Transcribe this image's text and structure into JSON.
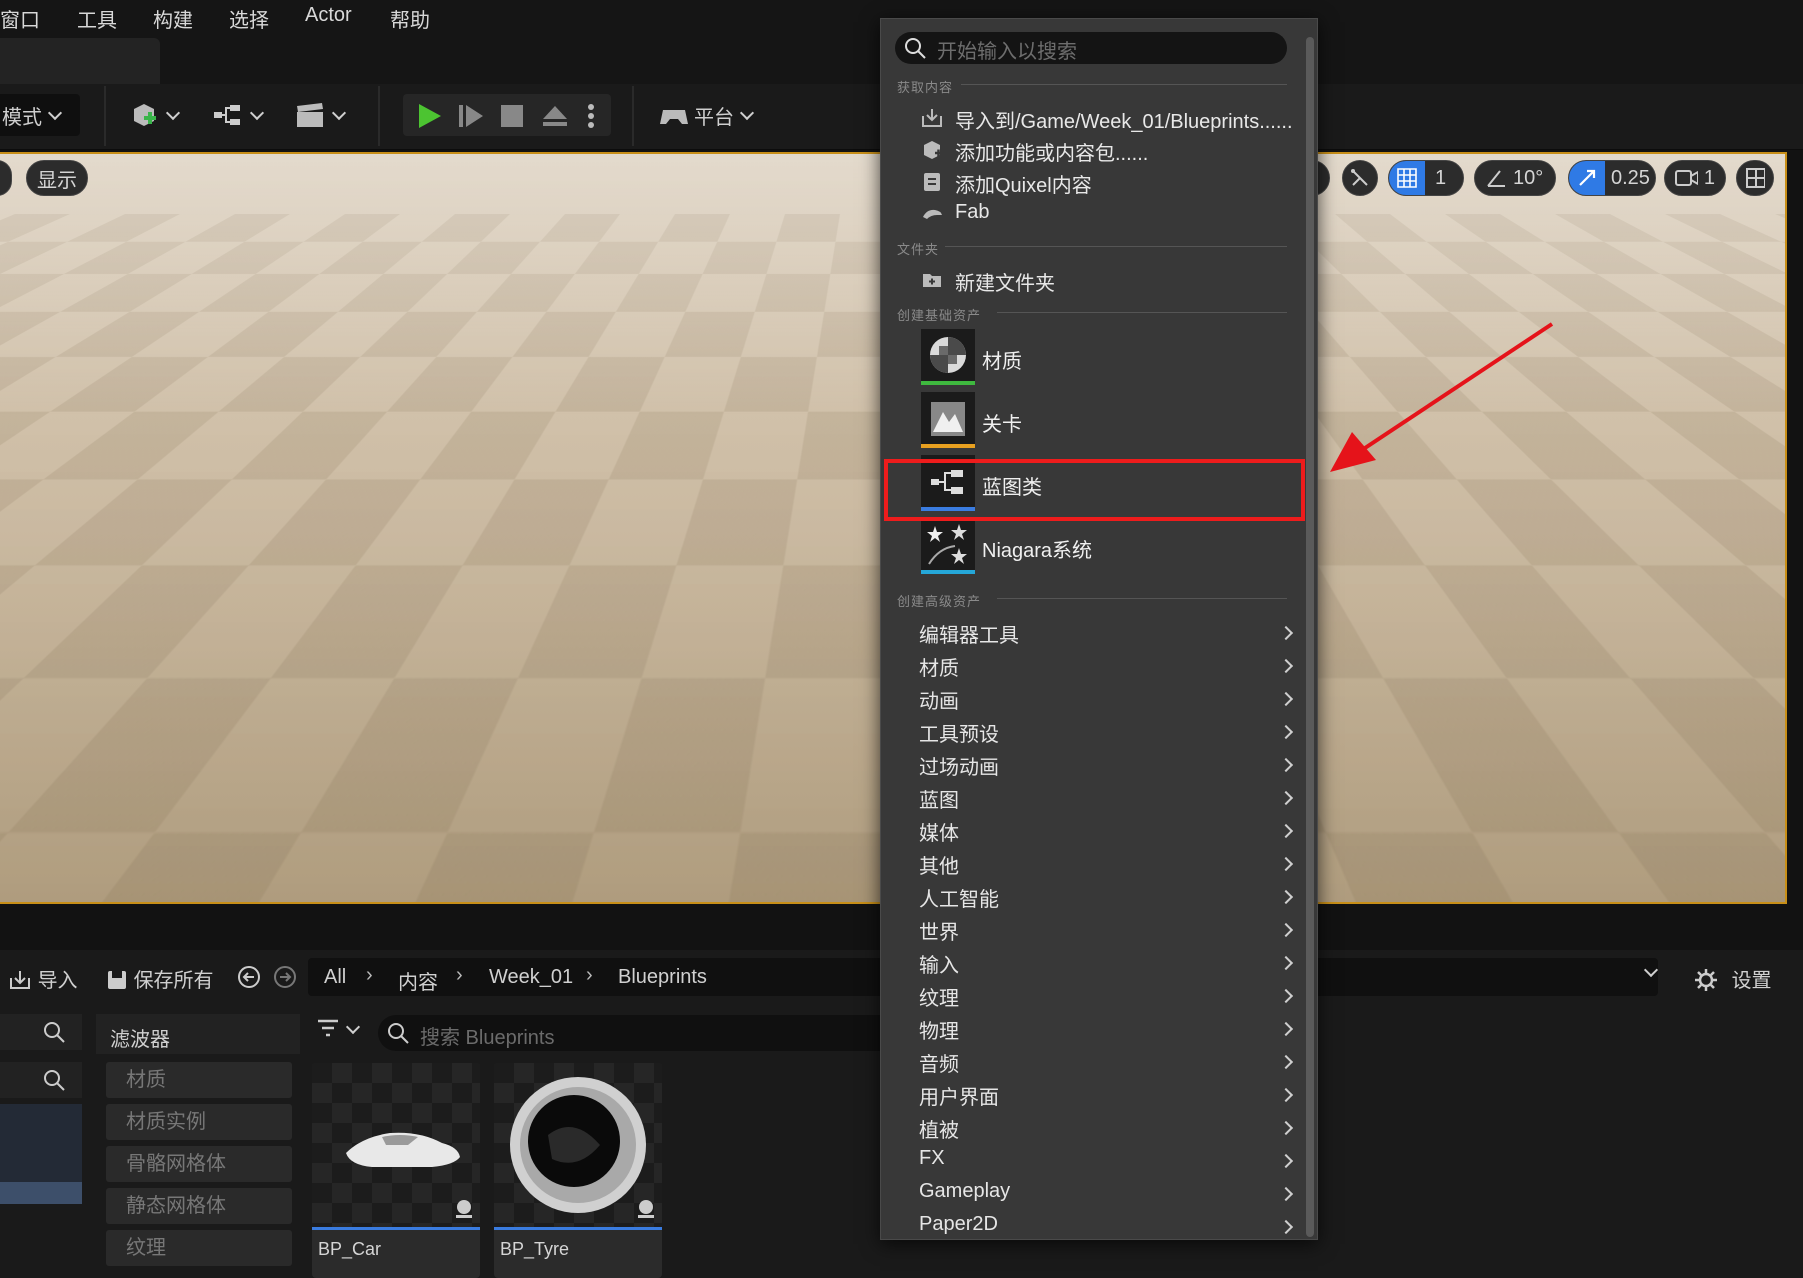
{
  "menubar": {
    "items": [
      "窗口",
      "工具",
      "构建",
      "选择",
      "Actor",
      "帮助"
    ]
  },
  "toolbar": {
    "mode": "模式",
    "platform": "平台"
  },
  "viewport": {
    "show_label": "显示",
    "grid_value": "1",
    "angle_value": "10°",
    "scale_value": "0.25",
    "camera_value": "1"
  },
  "content_browser": {
    "import": "导入",
    "save_all": "保存所有",
    "breadcrumb": [
      "All",
      "内容",
      "Week_01",
      "Blueprints"
    ],
    "settings": "设置",
    "filters_title": "滤波器",
    "filters": [
      "材质",
      "材质实例",
      "骨骼网格体",
      "静态网格体",
      "纹理"
    ],
    "search_placeholder": "搜索 Blueprints",
    "assets": [
      {
        "name": "BP_Car"
      },
      {
        "name": "BP_Tyre"
      }
    ]
  },
  "menu": {
    "search_placeholder": "开始输入以搜索",
    "get_content": {
      "header": "获取内容",
      "items": [
        "导入到/Game/Week_01/Blueprints......",
        "添加功能或内容包......",
        "添加Quixel内容",
        "Fab"
      ]
    },
    "folder": {
      "header": "文件夹",
      "items": [
        "新建文件夹"
      ]
    },
    "basic": {
      "header": "创建基础资产",
      "items": [
        {
          "label": "材质",
          "color": "#3fb93f"
        },
        {
          "label": "关卡",
          "color": "#e8a020"
        },
        {
          "label": "蓝图类",
          "color": "#3a7ce0"
        },
        {
          "label": "Niagara系统",
          "color": "#25a7d8"
        }
      ]
    },
    "advanced": {
      "header": "创建高级资产",
      "items": [
        "编辑器工具",
        "材质",
        "动画",
        "工具预设",
        "过场动画",
        "蓝图",
        "媒体",
        "其他",
        "人工智能",
        "世界",
        "输入",
        "纹理",
        "物理",
        "音频",
        "用户界面",
        "植被",
        "FX",
        "Gameplay",
        "Paper2D"
      ]
    }
  },
  "colors": {
    "highlight": "#ee1c1c",
    "accent": "#3a7ce0",
    "viewport_border": "#c88f18"
  }
}
